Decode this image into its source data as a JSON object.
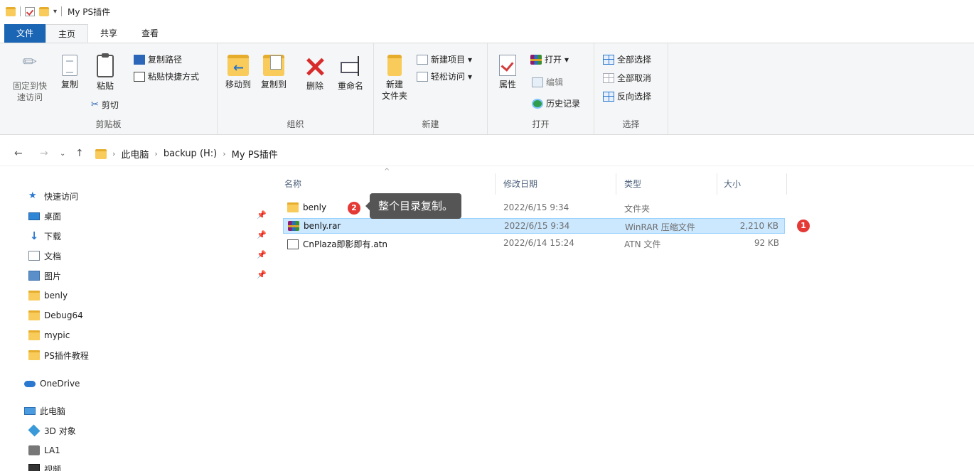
{
  "window": {
    "title": "My PS插件"
  },
  "tabs": [
    {
      "label": "文件"
    },
    {
      "label": "主页"
    },
    {
      "label": "共享"
    },
    {
      "label": "查看"
    }
  ],
  "ribbon": {
    "clipboard": {
      "group_label": "剪贴板",
      "pin_label_line1": "固定到快",
      "pin_label_line2": "速访问",
      "copy_label": "复制",
      "paste_label": "粘贴",
      "copy_path_label": "复制路径",
      "paste_shortcut_label": "粘贴快捷方式",
      "cut_label": "剪切"
    },
    "organize": {
      "group_label": "组织",
      "move_to_label": "移动到",
      "copy_to_label": "复制到",
      "delete_label": "删除",
      "rename_label": "重命名"
    },
    "new": {
      "group_label": "新建",
      "new_folder_line1": "新建",
      "new_folder_line2": "文件夹",
      "new_item_label": "新建项目",
      "easy_access_label": "轻松访问"
    },
    "open": {
      "group_label": "打开",
      "properties_label": "属性",
      "open_label": "打开",
      "edit_label": "编辑",
      "history_label": "历史记录"
    },
    "select": {
      "group_label": "选择",
      "select_all_label": "全部选择",
      "select_none_label": "全部取消",
      "invert_label": "反向选择"
    }
  },
  "address": {
    "crumbs": [
      "此电脑",
      "backup (H:)",
      "My PS插件"
    ]
  },
  "sidebar": {
    "quick_access": "快速访问",
    "items": [
      {
        "label": "桌面"
      },
      {
        "label": "下载"
      },
      {
        "label": "文档"
      },
      {
        "label": "图片"
      },
      {
        "label": "benly"
      },
      {
        "label": "Debug64"
      },
      {
        "label": "mypic"
      },
      {
        "label": "PS插件教程"
      }
    ],
    "onedrive": "OneDrive",
    "this_pc": "此电脑",
    "pc_items": [
      {
        "label": "3D 对象"
      },
      {
        "label": "LA1"
      },
      {
        "label": "视频"
      }
    ]
  },
  "filelist": {
    "columns": {
      "name": "名称",
      "date": "修改日期",
      "type": "类型",
      "size": "大小"
    },
    "rows": [
      {
        "name": "benly",
        "date": "2022/6/15 9:34",
        "type": "文件夹",
        "size": ""
      },
      {
        "name": "benly.rar",
        "date": "2022/6/15 9:34",
        "type": "WinRAR 压缩文件",
        "size": "2,210 KB"
      },
      {
        "name": "CnPlaza即影即有.atn",
        "date": "2022/6/14 15:24",
        "type": "ATN 文件",
        "size": "92 KB"
      }
    ]
  },
  "annotations": {
    "tooltip": "整个目录复制。",
    "badge1": "1",
    "badge2": "2"
  }
}
